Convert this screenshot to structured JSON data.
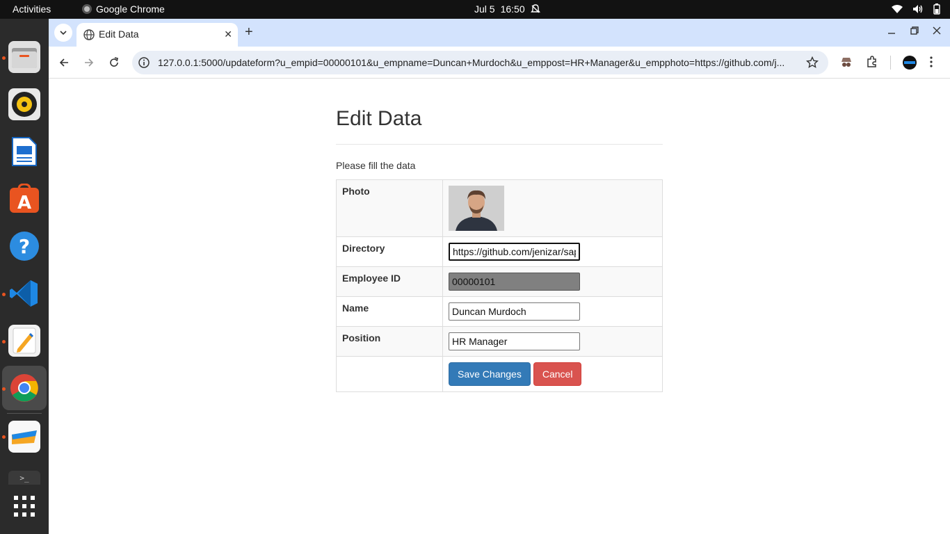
{
  "system_bar": {
    "activities": "Activities",
    "app_name": "Google Chrome",
    "date": "Jul 5",
    "time": "16:50"
  },
  "dock": {
    "items": [
      "files-icon",
      "rhythmbox-icon",
      "writer-icon",
      "software-icon",
      "help-icon",
      "vscode-icon",
      "text-editor-icon",
      "chrome-icon",
      "sticky-notes-icon",
      "terminal-icon",
      "apps-grid-icon"
    ]
  },
  "browser": {
    "tab_title": "Edit Data",
    "url": "127.0.0.1:5000/updateform?u_empid=00000101&u_empname=Duncan+Murdoch&u_emppost=HR+Manager&u_empphoto=https://github.com/j..."
  },
  "page": {
    "title": "Edit Data",
    "instructions": "Please fill the data",
    "form": {
      "photo_label": "Photo",
      "directory_label": "Directory",
      "directory_value": "https://github.com/jenizar/sap",
      "employee_id_label": "Employee ID",
      "employee_id_value": "00000101",
      "name_label": "Name",
      "name_value": "Duncan Murdoch",
      "position_label": "Position",
      "position_value": "HR Manager",
      "save_label": "Save Changes",
      "cancel_label": "Cancel"
    }
  },
  "colors": {
    "primary_button": "#337ab7",
    "danger_button": "#d9534f",
    "tabstrip": "#d3e3fd"
  }
}
